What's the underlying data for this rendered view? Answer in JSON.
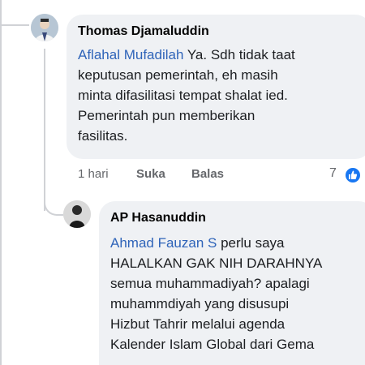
{
  "comment": {
    "author": "Thomas Djamaluddin",
    "mention": "Aflahal Mufadilah",
    "lines": [
      " Ya. Sdh tidak taat",
      "keputusan pemerintah, eh masih",
      "minta difasilitasi tempat shalat ied.",
      "Pemerintah pun memberikan",
      "fasilitas."
    ],
    "time": "1 hari",
    "like_label": "Suka",
    "reply_label": "Balas",
    "reaction_count": "7",
    "reaction_icon": "like-icon"
  },
  "reply": {
    "author": "AP Hasanuddin",
    "mention": "Ahmad Fauzan S",
    "lines": [
      " perlu saya",
      "HALALKAN GAK NIH DARAHNYA",
      "semua muhammadiyah? apalagi",
      "muhammdiyah yang disusupi",
      "Hizbut Tahrir melalui agenda",
      "Kalender Islam Global dari Gema"
    ]
  },
  "colors": {
    "mention": "#2f64b9",
    "bubble": "#eff1f4",
    "meta": "#65676b",
    "reaction": "#1877f2"
  }
}
